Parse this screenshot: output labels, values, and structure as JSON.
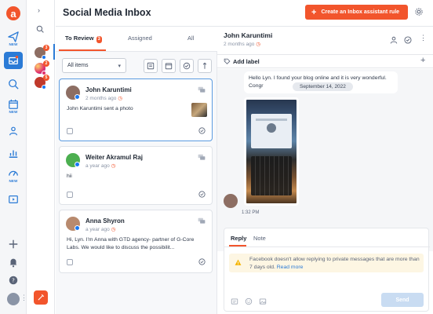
{
  "app": {
    "title": "Social Media Inbox",
    "logo_letter": "a",
    "create_button_label": "Create an Inbox assistant rule"
  },
  "nav": {
    "new_tag": "NEW",
    "icons": [
      "logo-icon",
      "send-icon",
      "inbox-icon",
      "search-analytics-icon",
      "calendar-icon",
      "team-icon",
      "analytics-icon",
      "dashboard-icon",
      "video-icon",
      "add-icon",
      "bell-icon",
      "help-icon",
      "user-icon"
    ]
  },
  "accounts": {
    "items": [
      {
        "badge": "3",
        "network": "facebook"
      },
      {
        "badge": "2",
        "network": "instagram"
      },
      {
        "badge": "5",
        "network": "facebook"
      }
    ]
  },
  "list": {
    "tabs": [
      {
        "label": "To Review",
        "count": "3"
      },
      {
        "label": "Assigned"
      },
      {
        "label": "All"
      }
    ],
    "filter": {
      "selected": "All items"
    },
    "cards": [
      {
        "name": "John Karuntimi",
        "time": "2 months ago",
        "text": "John Karuntimi sent a photo",
        "has_thumb": true
      },
      {
        "name": "Weiter Akramul Raj",
        "time": "a year ago",
        "text": "hii",
        "has_thumb": false
      },
      {
        "name": "Anna Shyron",
        "time": "a year ago",
        "text": "Hi, Lyn. I'm Anna with GTD agency- partner of G-Core Labs. We would like to discuss the possibilit...",
        "has_thumb": false
      }
    ]
  },
  "conversation": {
    "name": "John Karuntimi",
    "time": "2 months ago",
    "add_label": "Add label",
    "message_text": "Hello Lyn. I found your blog online and it is very wonderful. Congr",
    "date_separator": "September 14, 2022",
    "message_time": "1:32 PM"
  },
  "composer": {
    "tabs": [
      "Reply",
      "Note"
    ],
    "warning_text": "Facebook doesn't allow replying to private messages that are more than 7 days old.",
    "warning_link": "Read more",
    "send_label": "Send"
  },
  "colors": {
    "accent": "#f2552c",
    "primary": "#2b7bd6",
    "warning_bg": "#fdf6e3"
  }
}
